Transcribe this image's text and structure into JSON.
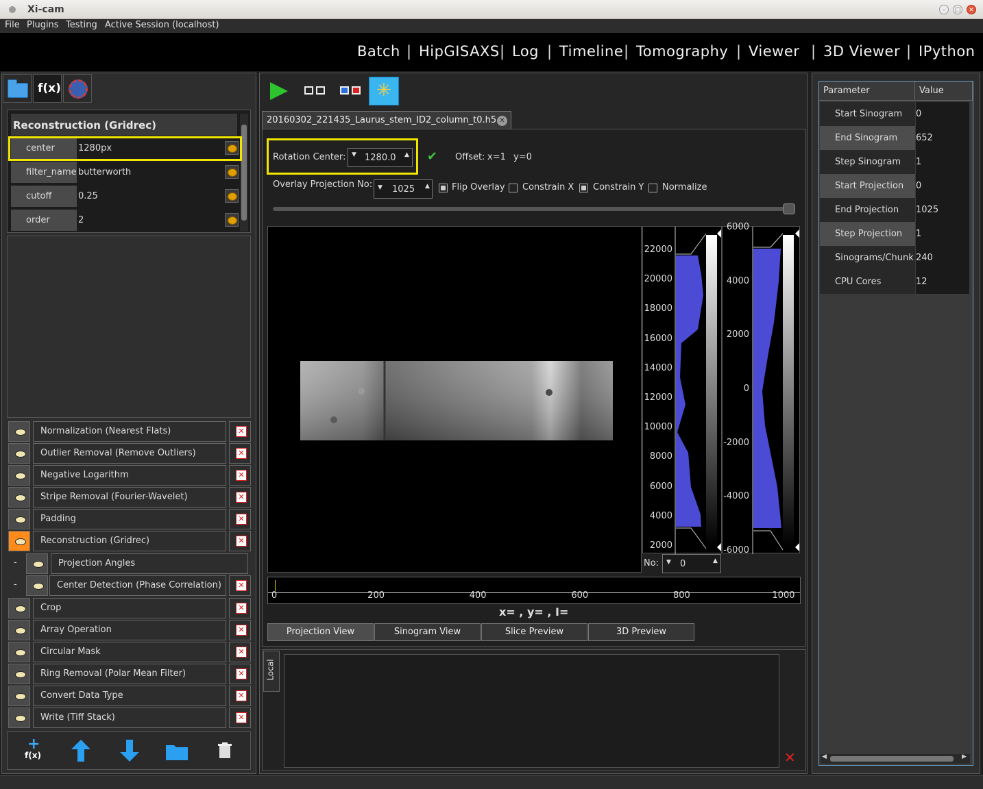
{
  "window": {
    "title": "Xi-cam"
  },
  "menubar": [
    "File",
    "Plugins",
    "Testing",
    "Active Session (localhost)"
  ],
  "nav": [
    "Batch",
    "HipGISAXS",
    "Log",
    "Timeline",
    "Tomography",
    "Viewer",
    "3D Viewer",
    "IPython"
  ],
  "left_tabs": {
    "fx_label": "f(x)"
  },
  "param_tree": {
    "title": "Reconstruction (Gridrec)",
    "rows": [
      {
        "name": "center",
        "value": "1280px"
      },
      {
        "name": "filter_name",
        "value": "butterworth"
      },
      {
        "name": "cutoff",
        "value": "0.25"
      },
      {
        "name": "order",
        "value": "2"
      }
    ]
  },
  "workflow": [
    {
      "label": "Normalization (Nearest Flats)",
      "eye": "normal"
    },
    {
      "label": "Outlier Removal (Remove Outliers)",
      "eye": "normal"
    },
    {
      "label": "Negative Logarithm",
      "eye": "normal"
    },
    {
      "label": "Stripe Removal (Fourier-Wavelet)",
      "eye": "normal"
    },
    {
      "label": "Padding",
      "eye": "normal"
    },
    {
      "label": "Reconstruction (Gridrec)",
      "eye": "active"
    },
    {
      "label": "Projection Angles",
      "eye": "normal",
      "child": true,
      "prefix": "-"
    },
    {
      "label": "Center Detection (Phase Correlation)",
      "eye": "normal",
      "child": true,
      "prefix": "-"
    },
    {
      "label": "Crop",
      "eye": "normal"
    },
    {
      "label": "Array Operation",
      "eye": "normal"
    },
    {
      "label": "Circular Mask",
      "eye": "normal"
    },
    {
      "label": "Ring Removal (Polar Mean Filter)",
      "eye": "closed"
    },
    {
      "label": "Convert Data Type",
      "eye": "closed"
    },
    {
      "label": "Write (Tiff Stack)",
      "eye": "normal"
    }
  ],
  "bottom_tools": {
    "add_label": "f(x)"
  },
  "file_tab": {
    "name": "20160302_221435_Laurus_stem_ID2_column_t0.h5"
  },
  "controls": {
    "rotation_center_label": "Rotation Center:",
    "rotation_center_value": "1280.0",
    "offset_label": "Offset:",
    "offset_x": "x=1",
    "offset_y": "y=0",
    "overlay_label": "Overlay Projection No:",
    "overlay_value": "1025",
    "flip_overlay": {
      "label": "Flip Overlay",
      "checked": true
    },
    "constrain_x": {
      "label": "Constrain X",
      "checked": false
    },
    "constrain_y": {
      "label": "Constrain Y",
      "checked": true
    },
    "normalize": {
      "label": "Normalize",
      "checked": false
    },
    "slider_value": 1.0
  },
  "histogram1": {
    "ticks": [
      "22000",
      "20000",
      "18000",
      "16000",
      "14000",
      "12000",
      "10000",
      "8000",
      "6000",
      "4000",
      "2000"
    ]
  },
  "histogram2": {
    "ticks": [
      "6000",
      "4000",
      "2000",
      "0",
      "-2000",
      "-4000",
      "-6000"
    ]
  },
  "frame_no": {
    "label": "No:",
    "value": "0"
  },
  "timeline": {
    "ticks": [
      "0",
      "200",
      "400",
      "600",
      "800",
      "1000"
    ]
  },
  "cursor_readout": "x= , y= , I=",
  "view_tabs": [
    "Projection View",
    "Sinogram View",
    "Slice Preview",
    "3D Preview"
  ],
  "console": {
    "side_tab": "Local"
  },
  "params_table": {
    "headers": [
      "Parameter",
      "Value"
    ],
    "rows": [
      {
        "k": "Start Sinogram",
        "v": "0"
      },
      {
        "k": "End Sinogram",
        "v": "652"
      },
      {
        "k": "Step Sinogram",
        "v": "1"
      },
      {
        "k": "Start Projection",
        "v": "0"
      },
      {
        "k": "End Projection",
        "v": "1025"
      },
      {
        "k": "Step Projection",
        "v": "1"
      },
      {
        "k": "Sinograms/Chunk",
        "v": "240"
      },
      {
        "k": "CPU Cores",
        "v": "12"
      }
    ]
  },
  "colors": {
    "accent": "#39b5f0",
    "highlight": "#f2e600",
    "active_eye": "#ff8c1a",
    "histogram_fill": "#4b4bd6"
  }
}
